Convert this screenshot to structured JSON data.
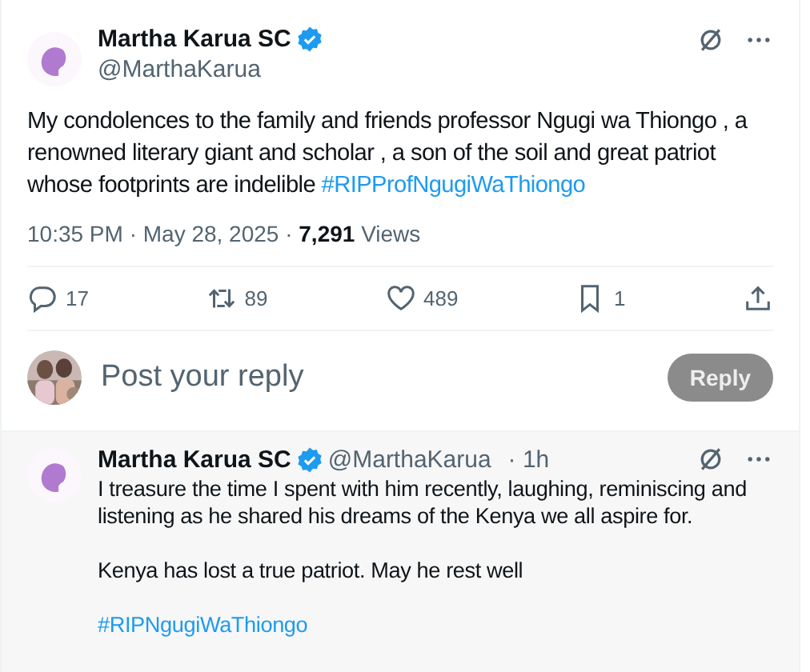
{
  "post": {
    "author": "Martha Karua SC",
    "verified": true,
    "handle": "@MarthaKarua",
    "text": "My condolences to the family and friends professor Ngugi wa Thiongo , a renowned literary giant and scholar , a son of the soil and great patriot whose footprints are indelible",
    "hashtag": "#RIPProfNgugiWaThiongo",
    "time": "10:35 PM · May 28, 2025 · ",
    "views_count": "7,291",
    "views_label": "Views",
    "actions": [
      {
        "kind": "reply",
        "count": "17"
      },
      {
        "kind": "repost",
        "count": "89"
      },
      {
        "kind": "like",
        "count": "489"
      },
      {
        "kind": "bookmark",
        "count": "1"
      },
      {
        "kind": "share"
      }
    ]
  },
  "composer": {
    "placeholder": "Post your reply",
    "button": {
      "label": "Reply",
      "disabled": true
    }
  },
  "replies": [
    {
      "author": "Martha Karua SC",
      "verified": true,
      "handle": "@MarthaKarua",
      "age": "· 1h",
      "paragraphs": [
        {
          "kind": "text",
          "text": "I treasure the time I spent with him recently,  laughing, reminiscing and listening as he shared his dreams of the Kenya we all aspire for."
        },
        {
          "kind": "text",
          "text": "Kenya has lost a true patriot. May he rest well"
        },
        {
          "kind": "hashtag",
          "text": "#RIPNgugiWaThiongo"
        }
      ]
    }
  ]
}
